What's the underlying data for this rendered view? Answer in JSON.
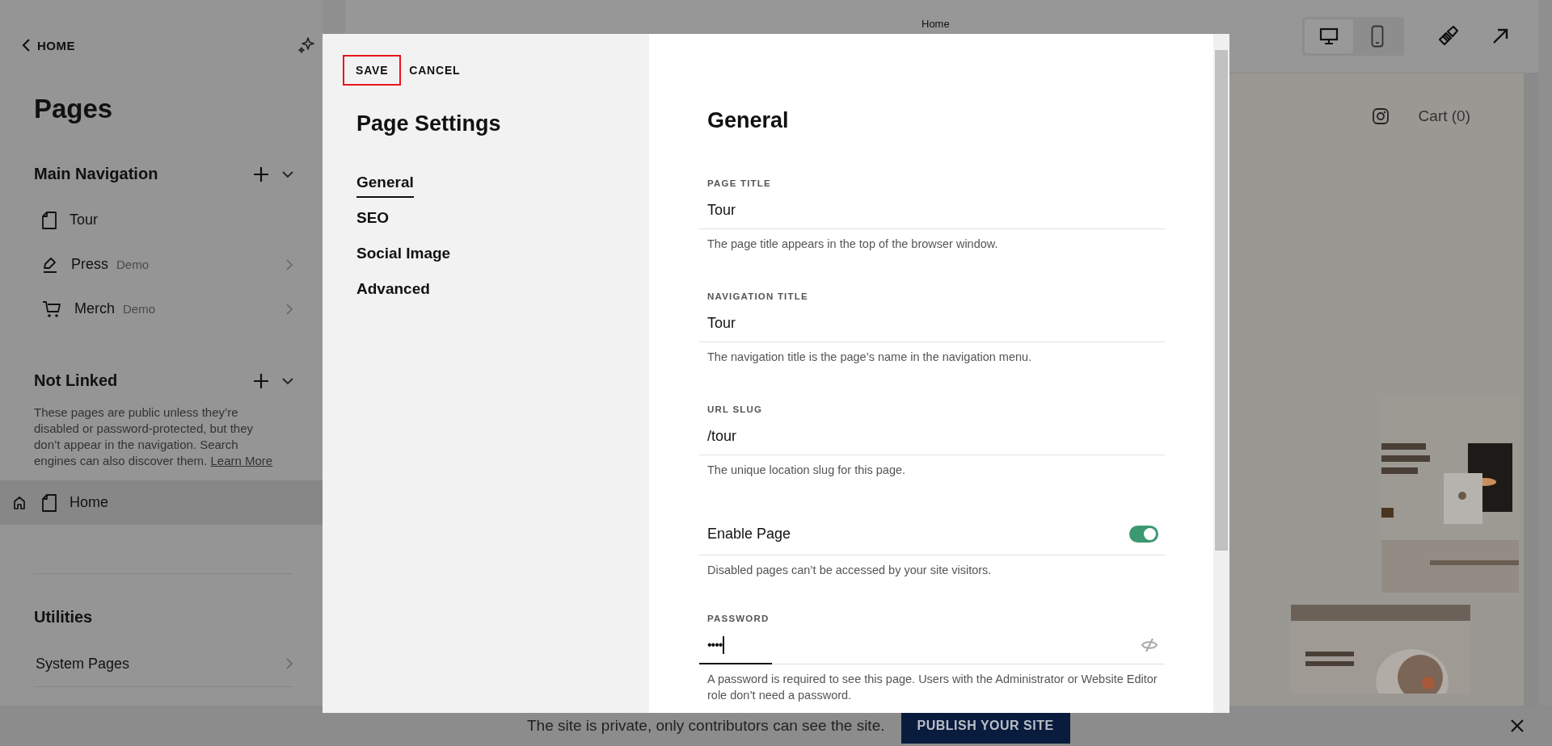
{
  "sidebar": {
    "back_link": "HOME",
    "title": "Pages",
    "sections": [
      {
        "title": "Main Navigation",
        "addable": true,
        "items": [
          {
            "label": "Tour",
            "kind": "page",
            "selected": false,
            "chevron": false
          },
          {
            "label": "Press",
            "badge": "Demo",
            "kind": "blog",
            "selected": false,
            "chevron": true
          },
          {
            "label": "Merch",
            "badge": "Demo",
            "kind": "store",
            "selected": false,
            "chevron": true
          }
        ]
      },
      {
        "title": "Not Linked",
        "addable": true,
        "description": "These pages are public unless they’re disabled or password-protected, but they don’t appear in the navigation. Search engines can also discover them.",
        "link": "Learn More",
        "items": [
          {
            "label": "Home",
            "kind": "page",
            "homepage": true,
            "selected": true,
            "chevron": false
          }
        ]
      },
      {
        "title": "Utilities",
        "addable": false,
        "items": [
          {
            "label": "System Pages",
            "kind": "plain",
            "selected": false,
            "chevron": true
          }
        ]
      }
    ]
  },
  "preview": {
    "page_title": "Home",
    "devices": [
      {
        "kind": "desktop",
        "selected": true
      },
      {
        "kind": "mobile",
        "selected": false
      }
    ],
    "cart": "Cart (0)"
  },
  "modal": {
    "save": "SAVE",
    "cancel": "CANCEL",
    "title": "Page Settings",
    "tabs": [
      {
        "label": "General",
        "selected": true
      },
      {
        "label": "SEO",
        "selected": false
      },
      {
        "label": "Social Image",
        "selected": false
      },
      {
        "label": "Advanced",
        "selected": false
      }
    ],
    "section_title": "General",
    "fields": [
      {
        "kind": "text",
        "label": "PAGE TITLE",
        "value": "Tour",
        "help": "The page title appears in the top of the browser window."
      },
      {
        "kind": "text",
        "label": "NAVIGATION TITLE",
        "value": "Tour",
        "help": "The navigation title is the page’s name in the navigation menu."
      },
      {
        "kind": "text",
        "label": "URL SLUG",
        "value": "/tour",
        "help": "The unique location slug for this page."
      },
      {
        "kind": "toggle",
        "label": "Enable Page",
        "on": true,
        "help": "Disabled pages can’t be accessed by your site visitors."
      },
      {
        "kind": "password",
        "label": "PASSWORD",
        "value": "••••",
        "help": "A password is required to see this page. Users with the Administrator or Website Editor role don’t need a password."
      }
    ]
  },
  "banner": {
    "message": "The site is private, only contributors can see the site.",
    "button": "PUBLISH YOUR SITE"
  }
}
